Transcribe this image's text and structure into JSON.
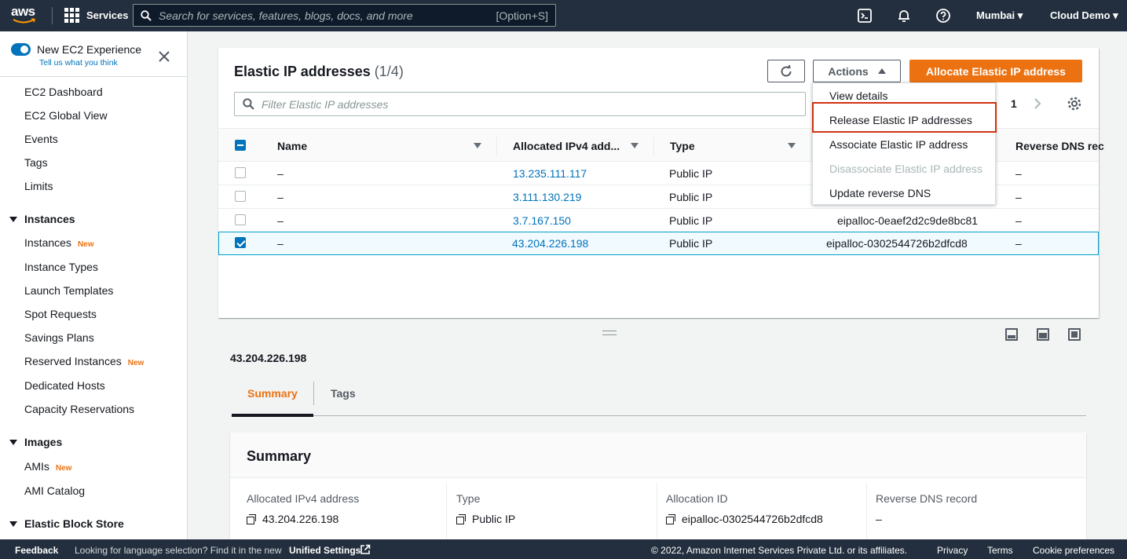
{
  "topnav": {
    "logo_text": "aws",
    "services_label": "Services",
    "search_placeholder": "Search for services, features, blogs, docs, and more",
    "search_shortcut": "[Option+S]",
    "region": "Mumbai ▾",
    "account": "Cloud Demo ▾"
  },
  "sidebar": {
    "experience_title": "New EC2 Experience",
    "experience_link": "Tell us what you think",
    "items": [
      {
        "label": "EC2 Dashboard"
      },
      {
        "label": "EC2 Global View"
      },
      {
        "label": "Events"
      },
      {
        "label": "Tags"
      },
      {
        "label": "Limits"
      }
    ],
    "instances_header": "Instances",
    "instances_items": [
      {
        "label": "Instances",
        "badge": "New"
      },
      {
        "label": "Instance Types",
        "badge": ""
      },
      {
        "label": "Launch Templates",
        "badge": ""
      },
      {
        "label": "Spot Requests",
        "badge": ""
      },
      {
        "label": "Savings Plans",
        "badge": ""
      },
      {
        "label": "Reserved Instances",
        "badge": "New"
      },
      {
        "label": "Dedicated Hosts",
        "badge": ""
      },
      {
        "label": "Capacity Reservations",
        "badge": ""
      }
    ],
    "images_header": "Images",
    "images_items": [
      {
        "label": "AMIs",
        "badge": "New"
      },
      {
        "label": "AMI Catalog",
        "badge": ""
      }
    ],
    "ebs_header": "Elastic Block Store"
  },
  "panel": {
    "title": "Elastic IP addresses",
    "count": "(1/4)",
    "actions_label": "Actions",
    "primary_label": "Allocate Elastic IP address",
    "filter_placeholder": "Filter Elastic IP addresses",
    "page": "1",
    "columns": [
      "Name",
      "Allocated IPv4 add...",
      "Type",
      "Reverse DNS rec"
    ],
    "rows": [
      {
        "name": "–",
        "ip": "13.235.111.117",
        "type": "Public IP",
        "alloc": "",
        "rdns": "–",
        "checked": false
      },
      {
        "name": "–",
        "ip": "3.111.130.219",
        "type": "Public IP",
        "alloc": "",
        "rdns": "–",
        "checked": false
      },
      {
        "name": "–",
        "ip": "3.7.167.150",
        "type": "Public IP",
        "alloc": "eipalloc-0eaef2d2c9de8bc81",
        "rdns": "–",
        "checked": false
      },
      {
        "name": "–",
        "ip": "43.204.226.198",
        "type": "Public IP",
        "alloc": "eipalloc-0302544726b2dfcd8",
        "rdns": "–",
        "checked": true
      }
    ]
  },
  "actions_menu": {
    "items": [
      {
        "label": "View details",
        "disabled": false
      },
      {
        "label": "Release Elastic IP addresses",
        "disabled": false
      },
      {
        "label": "Associate Elastic IP address",
        "disabled": false
      },
      {
        "label": "Disassociate Elastic IP address",
        "disabled": true
      },
      {
        "label": "Update reverse DNS",
        "disabled": false
      }
    ]
  },
  "detail": {
    "ip": "43.204.226.198",
    "tabs": [
      "Summary",
      "Tags"
    ],
    "summary_title": "Summary",
    "fields": [
      {
        "label": "Allocated IPv4 address",
        "value": "43.204.226.198"
      },
      {
        "label": "Type",
        "value": "Public IP"
      },
      {
        "label": "Allocation ID",
        "value": "eipalloc-0302544726b2dfcd8"
      },
      {
        "label": "Reverse DNS record",
        "value": "–"
      }
    ]
  },
  "footer": {
    "feedback": "Feedback",
    "lang_text": "Looking for language selection? Find it in the new",
    "lang_link": "Unified Settings",
    "copyright": "© 2022, Amazon Internet Services Private Ltd. or its affiliates.",
    "privacy": "Privacy",
    "terms": "Terms",
    "cookies": "Cookie preferences"
  },
  "colors": {
    "accent": "#ec7211",
    "link": "#0073bb",
    "nav": "#232f3e",
    "highlight": "#d13212"
  }
}
